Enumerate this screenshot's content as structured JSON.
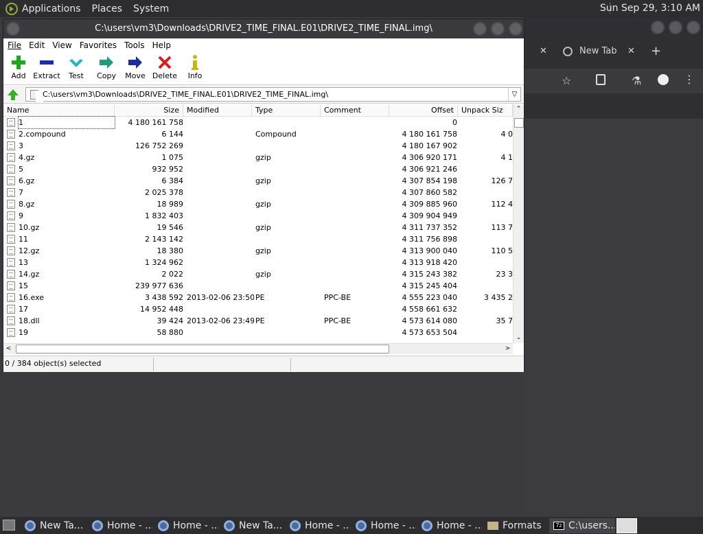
{
  "top_panel": {
    "menus": [
      "Applications",
      "Places",
      "System"
    ],
    "clock": "Sun Sep 29,  3:10 AM"
  },
  "chrome": {
    "tab_label": "New Tab",
    "close_glyph": "✕",
    "new_tab_glyph": "+"
  },
  "window": {
    "title": "C:\\users\\vm3\\Downloads\\DRIVE2_TIME_FINAL.E01\\DRIVE2_TIME_FINAL.img\\",
    "menu": [
      "File",
      "Edit",
      "View",
      "Favorites",
      "Tools",
      "Help"
    ],
    "toolbar": [
      "Add",
      "Extract",
      "Test",
      "Copy",
      "Move",
      "Delete",
      "Info"
    ],
    "address": "C:\\users\\vm3\\Downloads\\DRIVE2_TIME_FINAL.E01\\DRIVE2_TIME_FINAL.img\\",
    "columns": [
      "Name",
      "Size",
      "Modified",
      "Type",
      "Comment",
      "Offset",
      "Unpack Siz"
    ],
    "rows": [
      {
        "name": "1",
        "size": "4 180 161 758",
        "modified": "",
        "type": "",
        "comment": "",
        "offset": "0",
        "unpack": ""
      },
      {
        "name": "2.compound",
        "size": "6 144",
        "modified": "",
        "type": "Compound",
        "comment": "",
        "offset": "4 180 161 758",
        "unpack": "4 0"
      },
      {
        "name": "3",
        "size": "126 752 269",
        "modified": "",
        "type": "",
        "comment": "",
        "offset": "4 180 167 902",
        "unpack": ""
      },
      {
        "name": "4.gz",
        "size": "1 075",
        "modified": "",
        "type": "gzip",
        "comment": "",
        "offset": "4 306 920 171",
        "unpack": "4 1"
      },
      {
        "name": "5",
        "size": "932 952",
        "modified": "",
        "type": "",
        "comment": "",
        "offset": "4 306 921 246",
        "unpack": ""
      },
      {
        "name": "6.gz",
        "size": "6 384",
        "modified": "",
        "type": "gzip",
        "comment": "",
        "offset": "4 307 854 198",
        "unpack": "126 7"
      },
      {
        "name": "7",
        "size": "2 025 378",
        "modified": "",
        "type": "",
        "comment": "",
        "offset": "4 307 860 582",
        "unpack": ""
      },
      {
        "name": "8.gz",
        "size": "18 989",
        "modified": "",
        "type": "gzip",
        "comment": "",
        "offset": "4 309 885 960",
        "unpack": "112 4"
      },
      {
        "name": "9",
        "size": "1 832 403",
        "modified": "",
        "type": "",
        "comment": "",
        "offset": "4 309 904 949",
        "unpack": ""
      },
      {
        "name": "10.gz",
        "size": "19 546",
        "modified": "",
        "type": "gzip",
        "comment": "",
        "offset": "4 311 737 352",
        "unpack": "113 7"
      },
      {
        "name": "11",
        "size": "2 143 142",
        "modified": "",
        "type": "",
        "comment": "",
        "offset": "4 311 756 898",
        "unpack": ""
      },
      {
        "name": "12.gz",
        "size": "18 380",
        "modified": "",
        "type": "gzip",
        "comment": "",
        "offset": "4 313 900 040",
        "unpack": "110 5"
      },
      {
        "name": "13",
        "size": "1 324 962",
        "modified": "",
        "type": "",
        "comment": "",
        "offset": "4 313 918 420",
        "unpack": ""
      },
      {
        "name": "14.gz",
        "size": "2 022",
        "modified": "",
        "type": "gzip",
        "comment": "",
        "offset": "4 315 243 382",
        "unpack": "23 3"
      },
      {
        "name": "15",
        "size": "239 977 636",
        "modified": "",
        "type": "",
        "comment": "",
        "offset": "4 315 245 404",
        "unpack": ""
      },
      {
        "name": "16.exe",
        "size": "3 438 592",
        "modified": "2013-02-06 23:50",
        "type": "PE",
        "comment": "PPC-BE",
        "offset": "4 555 223 040",
        "unpack": "3 435 2"
      },
      {
        "name": "17",
        "size": "14 952 448",
        "modified": "",
        "type": "",
        "comment": "",
        "offset": "4 558 661 632",
        "unpack": ""
      },
      {
        "name": "18.dll",
        "size": "39 424",
        "modified": "2013-02-06 23:49",
        "type": "PE",
        "comment": "PPC-BE",
        "offset": "4 573 614 080",
        "unpack": "35 7"
      },
      {
        "name": "19",
        "size": "58 880",
        "modified": "",
        "type": "",
        "comment": "",
        "offset": "4 573 653 504",
        "unpack": ""
      }
    ],
    "status": "0 / 384 object(s) selected"
  },
  "taskbar": [
    {
      "label": "New Ta...",
      "icon": "chrome"
    },
    {
      "label": "Home - ...",
      "icon": "chrome"
    },
    {
      "label": "Home - ...",
      "icon": "chrome"
    },
    {
      "label": "New Ta...",
      "icon": "chrome"
    },
    {
      "label": "Home - ...",
      "icon": "chrome"
    },
    {
      "label": "Home - ...",
      "icon": "chrome"
    },
    {
      "label": "Home - ...",
      "icon": "chrome"
    },
    {
      "label": "Formats",
      "icon": "folder"
    },
    {
      "label": "C:\\users...",
      "icon": "7zip"
    }
  ]
}
